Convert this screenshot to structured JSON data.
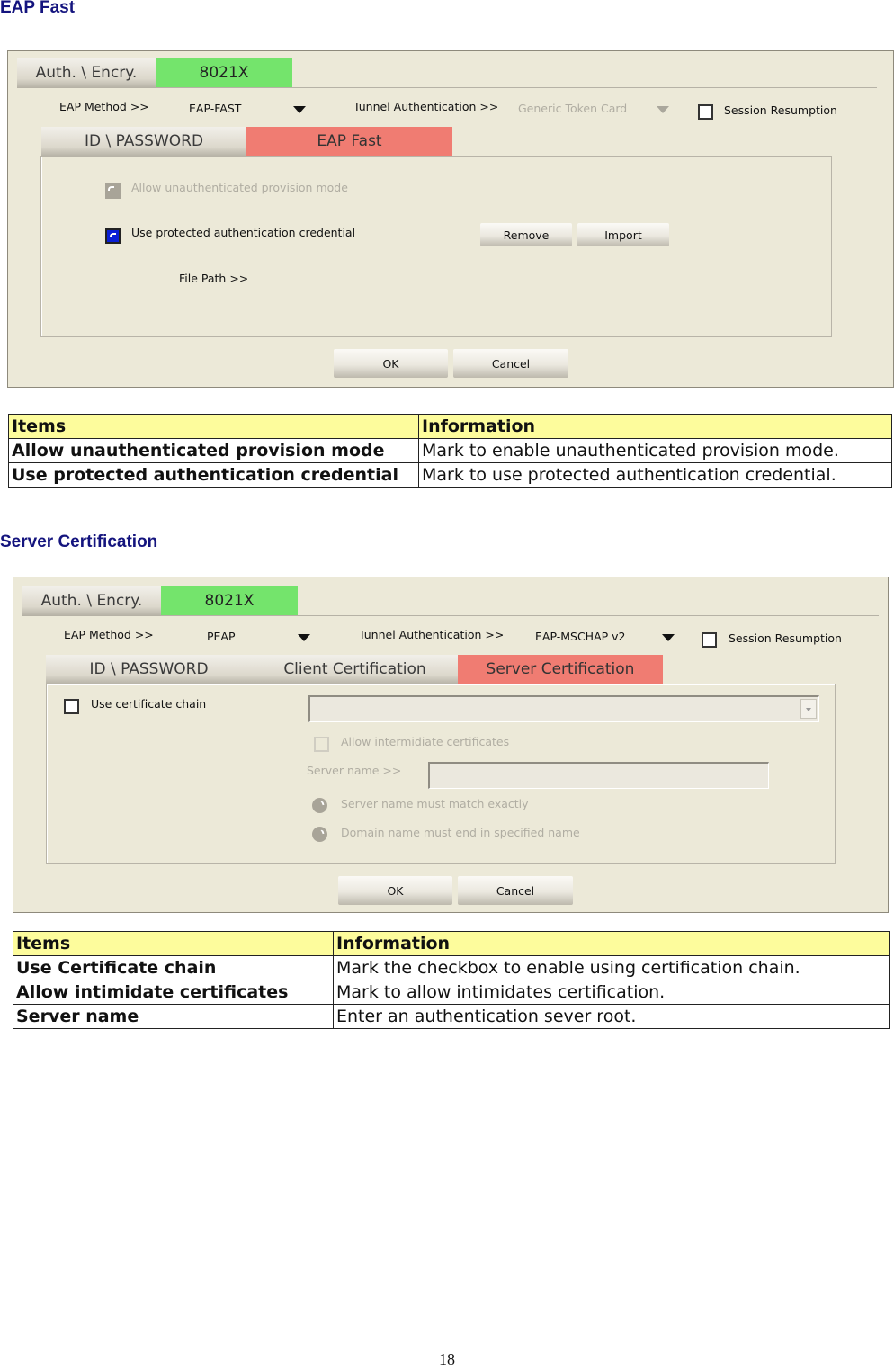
{
  "sections": {
    "eap_fast": {
      "heading": "EAP Fast",
      "dialog": {
        "tabs_top": [
          "Auth. \\ Encry.",
          "8021X"
        ],
        "eap_method_label": "EAP Method >>",
        "eap_method_value": "EAP-FAST",
        "tunnel_auth_label": "Tunnel Authentication >>",
        "tunnel_auth_value": "Generic Token Card",
        "session_resumption_label": "Session Resumption",
        "session_resumption_checked": false,
        "inner_tabs": [
          "ID \\ PASSWORD",
          "EAP Fast"
        ],
        "active_inner_tab": "EAP Fast",
        "allow_unauth_label": "Allow unauthenticated provision mode",
        "allow_unauth_checked": true,
        "allow_unauth_enabled": false,
        "use_protected_label": "Use protected authentication credential",
        "use_protected_checked": true,
        "remove_label": "Remove",
        "import_label": "Import",
        "file_path_label": "File Path >>",
        "ok_label": "OK",
        "cancel_label": "Cancel"
      },
      "table": {
        "headers": [
          "Items",
          "Information"
        ],
        "rows": [
          {
            "item": "Allow unauthenticated provision mode",
            "info": "Mark to enable unauthenticated provision mode."
          },
          {
            "item": "Use protected authentication credential",
            "info": "Mark to use protected authentication credential."
          }
        ]
      }
    },
    "server_cert": {
      "heading": "Server Certification",
      "dialog": {
        "tabs_top": [
          "Auth. \\ Encry.",
          "8021X"
        ],
        "eap_method_label": "EAP Method >>",
        "eap_method_value": "PEAP",
        "tunnel_auth_label": "Tunnel Authentication >>",
        "tunnel_auth_value": "EAP-MSCHAP v2",
        "session_resumption_label": "Session Resumption",
        "session_resumption_checked": false,
        "inner_tabs": [
          "ID \\ PASSWORD",
          "Client Certification",
          "Server Certification"
        ],
        "active_inner_tab": "Server Certification",
        "use_chain_label": "Use certificate chain",
        "use_chain_checked": false,
        "cert_select_value": "",
        "allow_intermediate_label": "Allow intermidiate certificates",
        "server_name_label": "Server name >>",
        "server_name_value": "",
        "radio_exact_label": "Server name must match exactly",
        "radio_domain_label": "Domain name must end in specified name",
        "ok_label": "OK",
        "cancel_label": "Cancel"
      },
      "table": {
        "headers": [
          "Items",
          "Information"
        ],
        "rows": [
          {
            "item": "Use Certificate chain",
            "info": "Mark the checkbox to enable using certification chain."
          },
          {
            "item": "Allow intimidate certificates",
            "info": "Mark to allow intimidates certification."
          },
          {
            "item": "Server name",
            "info": "Enter an authentication sever root."
          }
        ]
      }
    }
  },
  "colors": {
    "heading": "#14147e",
    "dialog_bg": "#ece9d8",
    "tab_active_green": "#74e46c",
    "tab_active_red": "#f07c72",
    "table_header_bg": "#fdfc9c",
    "checkbox_checked": "#0a1fd6"
  },
  "page_number": "18"
}
